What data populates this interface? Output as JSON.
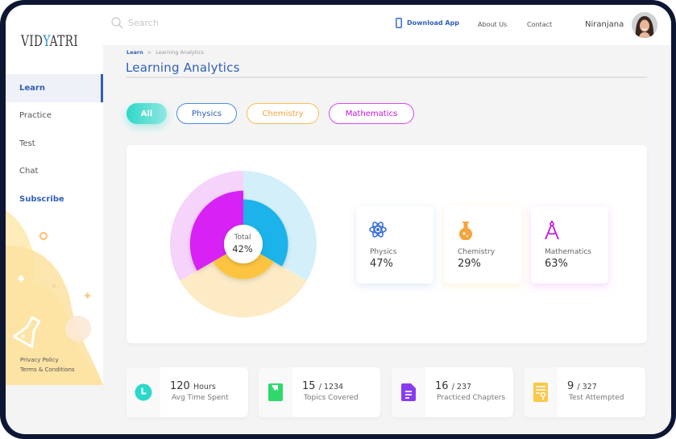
{
  "brand": {
    "logo_left": "VID",
    "logo_mark": "Y",
    "logo_right": "ATRI"
  },
  "sidebar": {
    "items": [
      {
        "label": "Learn",
        "active": true
      },
      {
        "label": "Practice"
      },
      {
        "label": "Test"
      },
      {
        "label": "Chat"
      },
      {
        "label": "Subscribe"
      }
    ],
    "footer_links": [
      "Privacy Policy",
      "Terms & Conditions"
    ]
  },
  "header": {
    "search_placeholder": "Search",
    "download_label": "Download App",
    "about_label": "About Us",
    "contact_label": "Contact",
    "user_name": "Niranjana"
  },
  "breadcrumb": {
    "root": "Learn",
    "separator": ">",
    "current": "Learning Analytics"
  },
  "page_title": "Learning Analytics",
  "filters": [
    {
      "label": "All",
      "selected": true
    },
    {
      "label": "Physics"
    },
    {
      "label": "Chemistry"
    },
    {
      "label": "Mathematics"
    }
  ],
  "chart_data": {
    "type": "pie",
    "title": "",
    "center_label": "Total",
    "center_value": "42%",
    "total_percent": 42,
    "series": [
      {
        "name": "Physics",
        "value": 47,
        "color": "#1cb3ea",
        "track_color": "#d3f0fa"
      },
      {
        "name": "Chemistry",
        "value": 29,
        "color": "#fcc43f",
        "track_color": "#fdebc6"
      },
      {
        "name": "Mathematics",
        "value": 63,
        "color": "#d821f5",
        "track_color": "#f6d3fb"
      }
    ]
  },
  "subjects": [
    {
      "name": "Physics",
      "percent": "47%",
      "icon": "atom-icon",
      "color": "#3a6fd8"
    },
    {
      "name": "Chemistry",
      "percent": "29%",
      "icon": "flask-icon",
      "color": "#f7a33b"
    },
    {
      "name": "Mathematics",
      "percent": "63%",
      "icon": "compass-icon",
      "color": "#c415e0"
    }
  ],
  "stats": [
    {
      "value": "120",
      "unit": "Hours",
      "label": "Avg Time Spent",
      "icon": "clock-icon",
      "color": "#2bd9cb"
    },
    {
      "value": "15",
      "unit": "/ 1234",
      "label": "Topics Covered",
      "icon": "book-icon",
      "color": "#2fd86c"
    },
    {
      "value": "16",
      "unit": "/ 237",
      "label": "Practiced Chapters",
      "icon": "document-icon",
      "color": "#8a3cf0"
    },
    {
      "value": "9",
      "unit": "/ 327",
      "label": "Test Attempted",
      "icon": "certificate-icon",
      "color": "#fcc84a"
    }
  ]
}
